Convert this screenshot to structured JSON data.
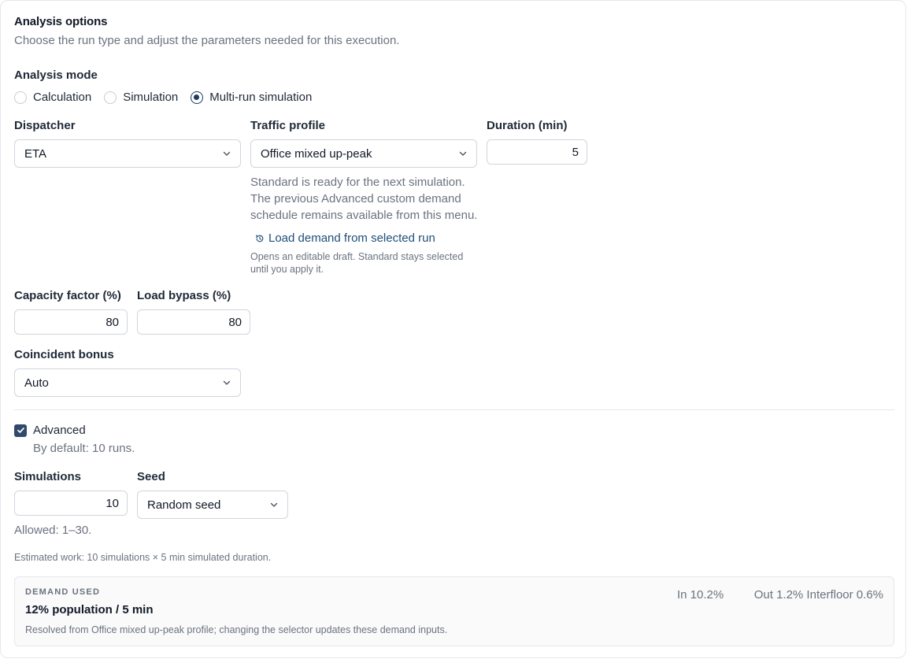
{
  "header": {
    "title": "Analysis options",
    "subtitle": "Choose the run type and adjust the parameters needed for this execution."
  },
  "mode": {
    "label": "Analysis mode",
    "options": [
      "Calculation",
      "Simulation",
      "Multi-run simulation"
    ],
    "selected": "Multi-run simulation"
  },
  "dispatcher": {
    "label": "Dispatcher",
    "value": "ETA"
  },
  "traffic": {
    "label": "Traffic profile",
    "value": "Office mixed up-peak",
    "help_lines": [
      "Standard is ready for the next simulation.",
      "The previous Advanced custom demand",
      "schedule remains available from this menu."
    ],
    "load_link": "Load demand from selected run",
    "note_lines": [
      "Opens an editable draft. Standard stays selected",
      "until you apply it."
    ]
  },
  "duration": {
    "label": "Duration (min)",
    "value": "5"
  },
  "capacity": {
    "label": "Capacity factor (%)",
    "value": "80"
  },
  "bypass": {
    "label": "Load bypass (%)",
    "value": "80"
  },
  "coincident": {
    "label": "Coincident bonus",
    "value": "Auto"
  },
  "advanced": {
    "label": "Advanced",
    "checked": true,
    "default_note": "By default: 10 runs."
  },
  "simulations": {
    "label": "Simulations",
    "value": "10",
    "allowed": "Allowed: 1–30."
  },
  "seed": {
    "label": "Seed",
    "value": "Random seed"
  },
  "estimate": "Estimated work: 10 simulations × 5 min simulated duration.",
  "demand": {
    "heading": "DEMAND USED",
    "value": "12% population / 5 min",
    "in": "In 10.2%",
    "out_inter": "Out 1.2% Interfloor 0.6%",
    "note": "Resolved from Office mixed up-peak profile; changing the selector updates these demand inputs."
  },
  "colors": {
    "accent": "#1f3a5f",
    "link": "#1f4e79",
    "muted": "#6b7280"
  }
}
